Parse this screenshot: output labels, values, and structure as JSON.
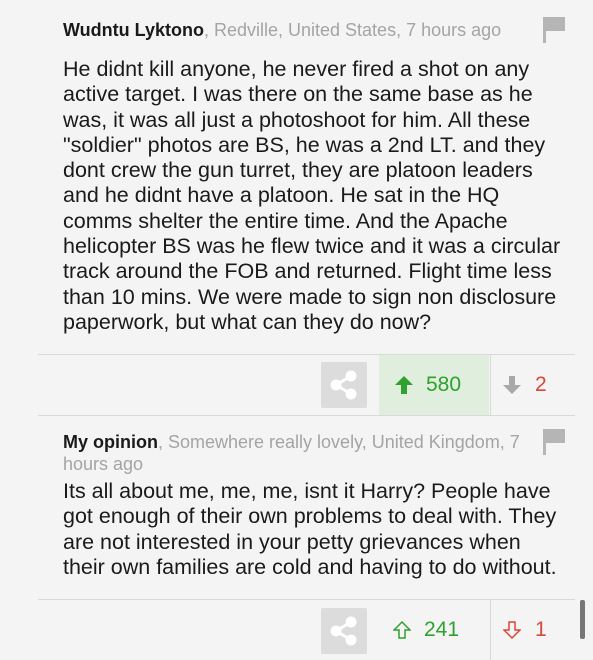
{
  "comments": [
    {
      "author": "Wudntu Lyktono",
      "meta": ", Redville, United States, 7 hours ago",
      "body": "He didnt kill anyone, he never fired a shot on any active target. I was there on the same base as he was, it was all just a photoshoot for him. All these \"soldier\" photos are BS, he was a 2nd LT. and they dont crew the gun turret, they are platoon leaders and he didnt have a platoon. He sat in the HQ comms shelter the entire time. And the Apache helicopter BS was he flew twice and it was a circular track around the FOB and returned. Flight time less than 10 mins. We were made to sign non disclosure paperwork, but what can they do now?",
      "upvotes": "580",
      "downvotes": "2"
    },
    {
      "author": "My opinion",
      "meta": ", Somewhere really lovely, United Kingdom, 7 hours ago",
      "body": "Its all about me, me, me, isnt it Harry? People have got enough of their own problems to deal with. They are not interested in your petty grievances when their own families are cold and having to do without.",
      "upvotes": "241",
      "downvotes": "1"
    }
  ],
  "icons": {
    "flag": "flag-icon",
    "share": "share-icon",
    "upvote": "arrow-up-icon",
    "downvote": "arrow-down-icon"
  },
  "colors": {
    "upvote": "#2ea12e",
    "downvote": "#d9463a",
    "upvote_active_bg": "#dfeedd",
    "meta_text": "#a4a4a4"
  }
}
